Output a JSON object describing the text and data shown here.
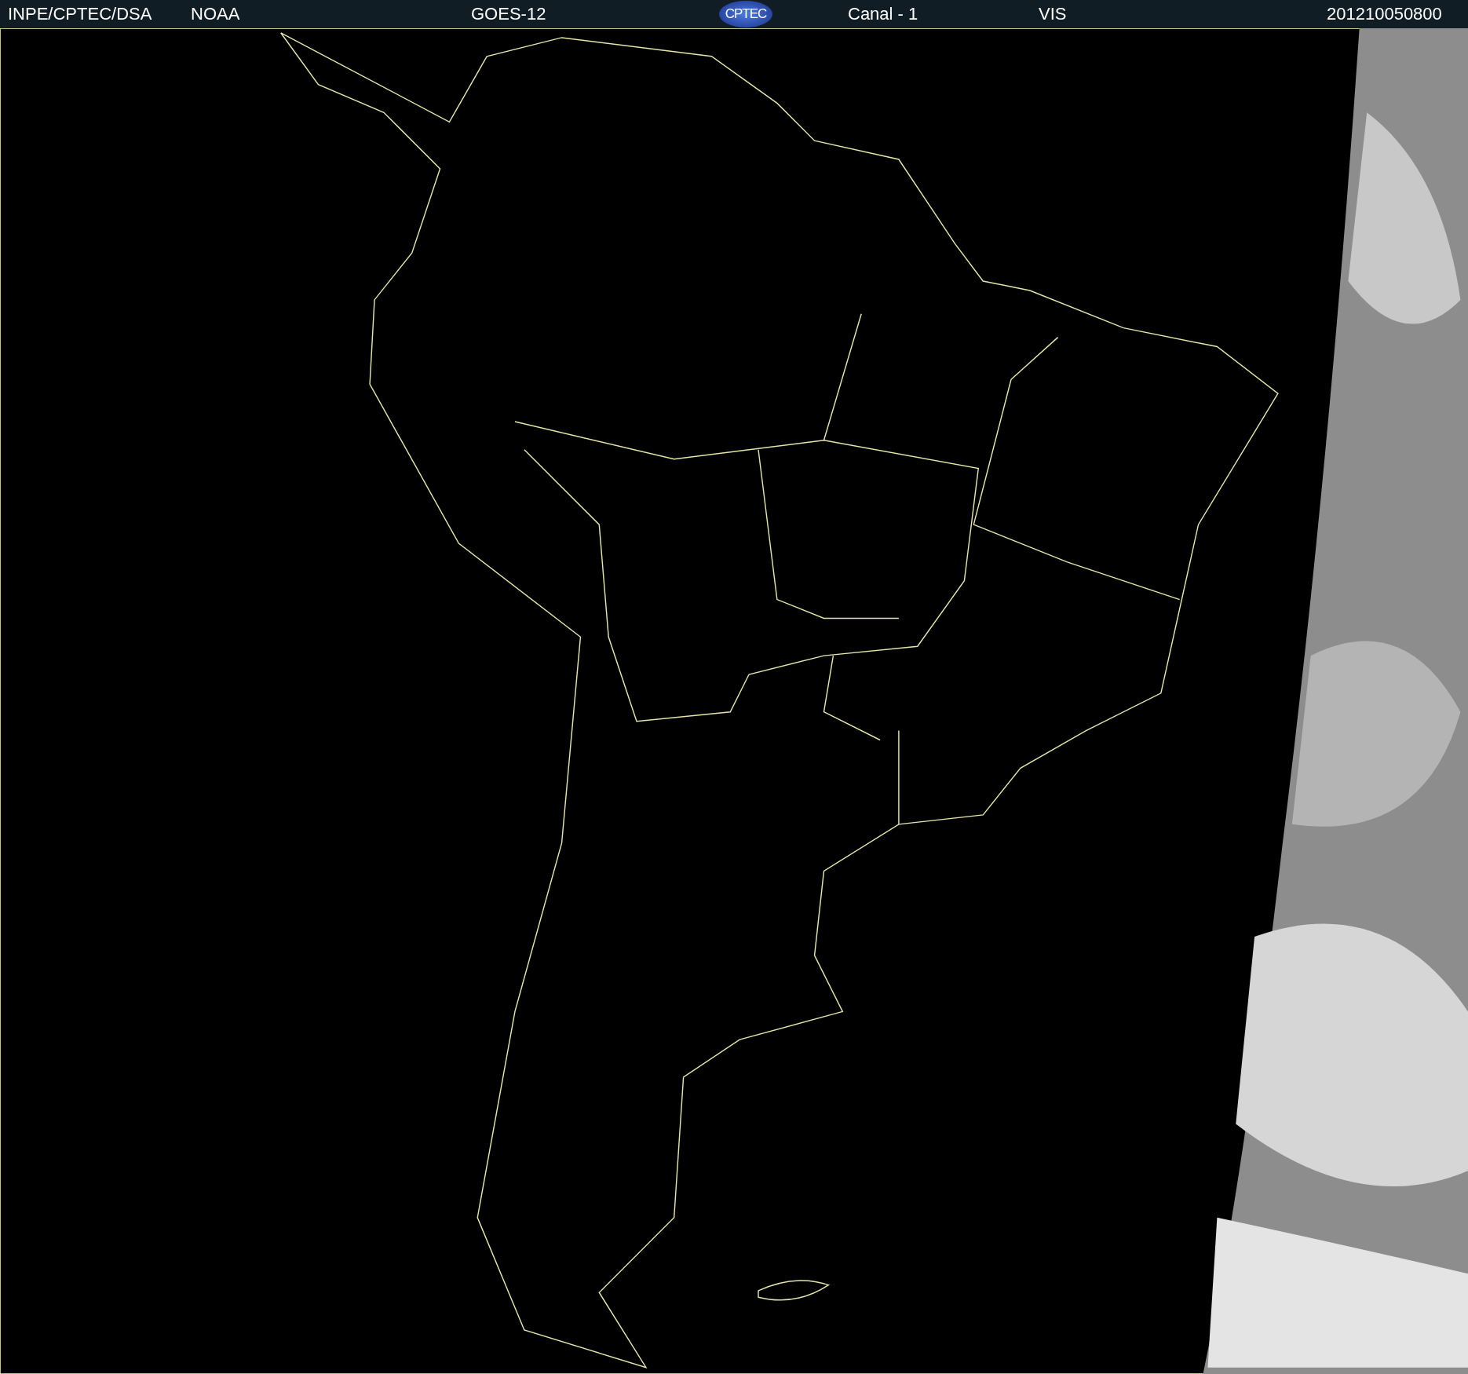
{
  "header": {
    "items": [
      {
        "kind": "text",
        "text": "INPE/CPTEC/DSA"
      },
      {
        "kind": "text",
        "text": "NOAA"
      },
      {
        "kind": "text",
        "text": "GOES-12"
      },
      {
        "kind": "logo",
        "text": "CPTEC"
      },
      {
        "kind": "text",
        "text": "Canal - 1"
      },
      {
        "kind": "text",
        "text": "VIS"
      },
      {
        "kind": "text",
        "text": "201210050800"
      }
    ]
  }
}
